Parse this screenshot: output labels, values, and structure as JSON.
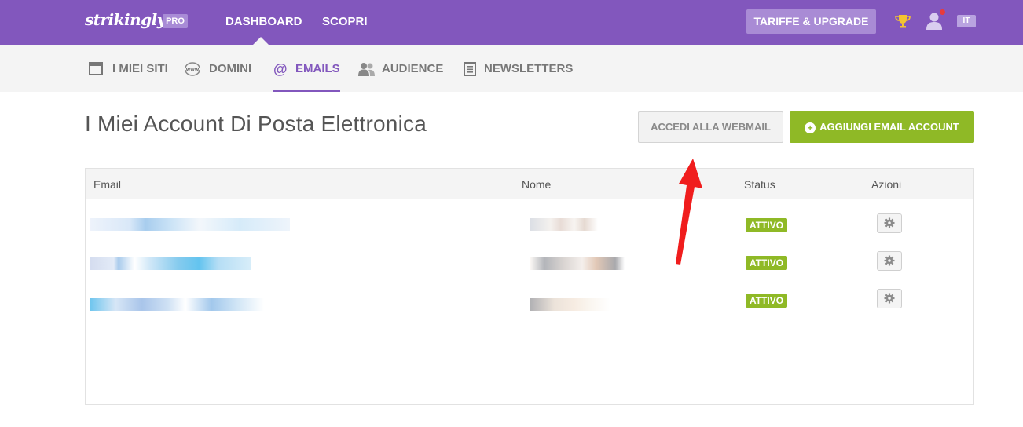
{
  "brand": {
    "logo": "strikingly",
    "badge": "PRO",
    "lang": "IT"
  },
  "topnav": {
    "dashboard": "DASHBOARD",
    "scopri": "SCOPRI",
    "upgrade": "TARIFFE & UPGRADE"
  },
  "subnav": {
    "items": [
      {
        "label": "I MIEI SITI",
        "icon": "browser-window-icon"
      },
      {
        "label": "DOMINI",
        "icon": "www-globe-icon"
      },
      {
        "label": "EMAILS",
        "icon": "at-sign-icon",
        "active": true
      },
      {
        "label": "AUDIENCE",
        "icon": "people-icon"
      },
      {
        "label": "NEWSLETTERS",
        "icon": "newsletter-icon"
      }
    ]
  },
  "main": {
    "title": "I Miei Account Di Posta Elettronica",
    "webmail_button": "ACCEDI ALLA WEBMAIL",
    "add_button": "AGGIUNGI EMAIL ACCOUNT"
  },
  "table": {
    "headers": {
      "email": "Email",
      "name": "Nome",
      "status": "Status",
      "actions": "Azioni"
    },
    "rows": [
      {
        "status": "ATTIVO"
      },
      {
        "status": "ATTIVO"
      },
      {
        "status": "ATTIVO"
      }
    ]
  },
  "colors": {
    "brand": "#8257bd",
    "accent_green": "#8fb926",
    "annotation_arrow": "#f01d1d"
  }
}
